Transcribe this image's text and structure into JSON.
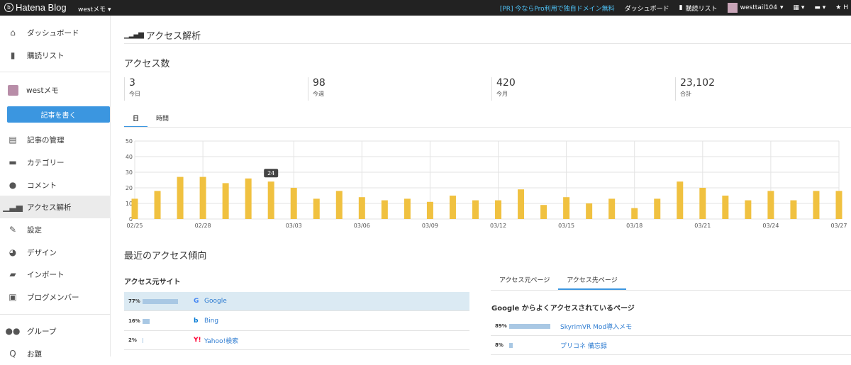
{
  "topbar": {
    "logo": "Hatena Blog",
    "blog_select": "westメモ",
    "pr": "[PR] 今ならPro利用で独自ドメイン無料",
    "dashboard": "ダッシュボード",
    "reading_list": "購読リスト",
    "username": "westtail104"
  },
  "sidebar": {
    "dashboard": "ダッシュボード",
    "reading_list": "購読リスト",
    "blog_name": "westメモ",
    "write_button": "記事を書く",
    "items": [
      {
        "label": "記事の管理",
        "icon": "document-icon"
      },
      {
        "label": "カテゴリー",
        "icon": "folder-icon"
      },
      {
        "label": "コメント",
        "icon": "comment-icon"
      },
      {
        "label": "アクセス解析",
        "icon": "bar-chart-icon"
      },
      {
        "label": "設定",
        "icon": "wrench-icon"
      },
      {
        "label": "デザイン",
        "icon": "palette-icon"
      },
      {
        "label": "インポート",
        "icon": "truck-icon"
      },
      {
        "label": "ブログメンバー",
        "icon": "members-icon"
      }
    ],
    "group": "グループ",
    "odai": "お題"
  },
  "page": {
    "title": "アクセス解析",
    "access_count_heading": "アクセス数",
    "stats": [
      {
        "value": "3",
        "label": "今日"
      },
      {
        "value": "98",
        "label": "今週"
      },
      {
        "value": "420",
        "label": "今月"
      },
      {
        "value": "23,102",
        "label": "合計"
      }
    ],
    "tabs": [
      "日",
      "時間"
    ],
    "recent_heading": "最近のアクセス傾向",
    "source_heading": "アクセス元サイト",
    "sources": [
      {
        "pct": "77%",
        "fraction": 0.77,
        "name": "Google",
        "icon": "google-icon",
        "highlighted": true
      },
      {
        "pct": "16%",
        "fraction": 0.16,
        "name": "Bing",
        "icon": "bing-icon",
        "highlighted": false
      },
      {
        "pct": "2%",
        "fraction": 0.02,
        "name": "Yahoo!検索",
        "icon": "yahoo-icon",
        "highlighted": false
      }
    ],
    "right_tabs": [
      "アクセス元ページ",
      "アクセス先ページ"
    ],
    "google_pages_heading": "Google からよくアクセスされているページ",
    "pages": [
      {
        "pct": "89%",
        "fraction": 0.89,
        "title": "SkyrimVR Mod導入メモ"
      },
      {
        "pct": "8%",
        "fraction": 0.08,
        "title": "プリコネ 備忘録"
      }
    ]
  },
  "chart_data": {
    "type": "bar",
    "x": [
      "02/25",
      "02/26",
      "02/27",
      "02/28",
      "02/29",
      "03/01",
      "03/02",
      "03/03",
      "03/04",
      "03/05",
      "03/06",
      "03/07",
      "03/08",
      "03/09",
      "03/10",
      "03/11",
      "03/12",
      "03/13",
      "03/14",
      "03/15",
      "03/16",
      "03/17",
      "03/18",
      "03/19",
      "03/20",
      "03/21",
      "03/22",
      "03/23",
      "03/24",
      "03/25",
      "03/26",
      "03/27"
    ],
    "tick_labels": [
      "02/25",
      "02/28",
      "03/03",
      "03/06",
      "03/09",
      "03/12",
      "03/15",
      "03/18",
      "03/21",
      "03/24",
      "03/27"
    ],
    "values": [
      13,
      18,
      27,
      27,
      23,
      26,
      24,
      20,
      13,
      18,
      14,
      12,
      13,
      11,
      15,
      12,
      12,
      19,
      9,
      14,
      10,
      13,
      7,
      13,
      24,
      20,
      15,
      12,
      18,
      12,
      18,
      18
    ],
    "ylim": [
      0,
      50
    ],
    "yticks": [
      0,
      10,
      20,
      30,
      40,
      50
    ],
    "tooltip_label": "24",
    "tooltip_index": 6,
    "bar_color": "#f0c140",
    "grid": true
  }
}
